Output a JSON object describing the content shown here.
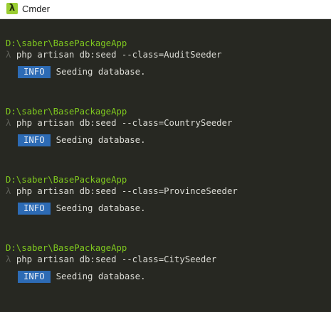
{
  "window": {
    "title": "Cmder",
    "icon": "lambda-icon",
    "icon_glyph": "λ"
  },
  "colors": {
    "background": "#272822",
    "path": "#7fc81f",
    "prompt": "#5e5f58",
    "command": "#dcdcd6",
    "badge_bg": "#2d6bb5",
    "app_icon": "#9acd32"
  },
  "terminal": {
    "prompt_symbol": "λ",
    "blocks": [
      {
        "path": "D:\\saber\\BasePackageApp",
        "command": "php artisan db:seed --class=AuditSeeder",
        "badge": "INFO",
        "message": "Seeding database."
      },
      {
        "path": "D:\\saber\\BasePackageApp",
        "command": "php artisan db:seed --class=CountrySeeder",
        "badge": "INFO",
        "message": "Seeding database."
      },
      {
        "path": "D:\\saber\\BasePackageApp",
        "command": "php artisan db:seed --class=ProvinceSeeder",
        "badge": "INFO",
        "message": "Seeding database."
      },
      {
        "path": "D:\\saber\\BasePackageApp",
        "command": "php artisan db:seed --class=CitySeeder",
        "badge": "INFO",
        "message": "Seeding database."
      }
    ]
  }
}
